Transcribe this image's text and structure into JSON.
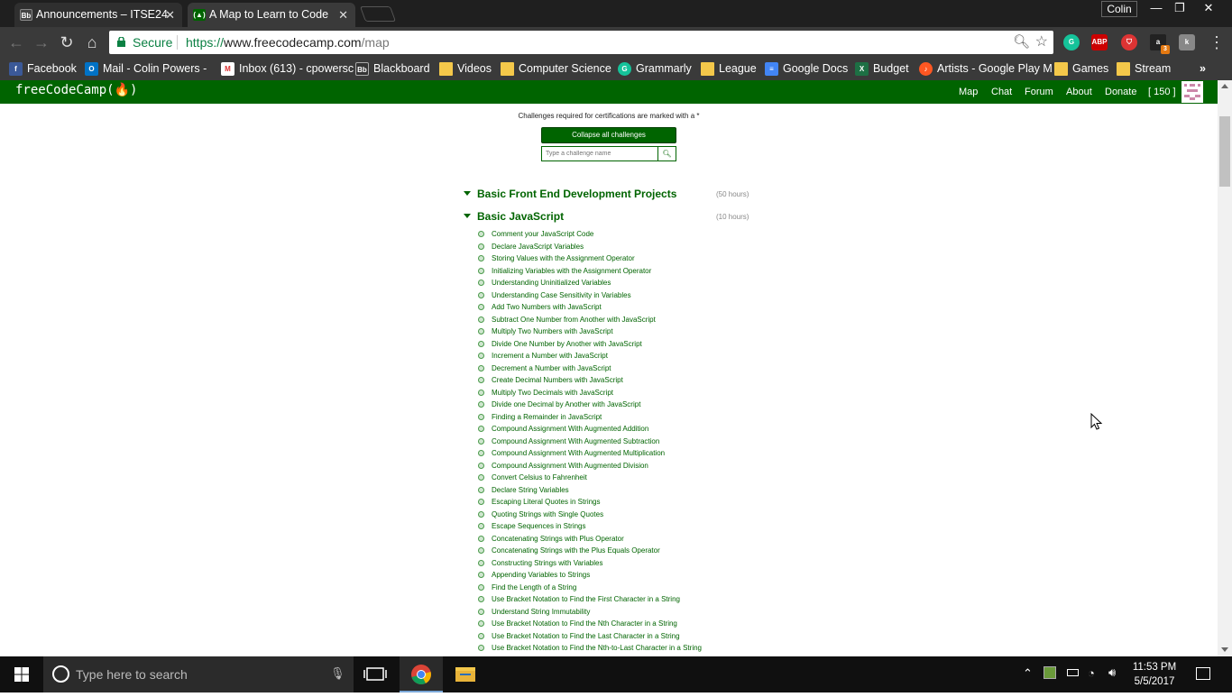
{
  "browser": {
    "tabs": [
      {
        "title": "Announcements – ITSE24",
        "icon": "Bb",
        "active": false
      },
      {
        "title": "A Map to Learn to Code",
        "icon": "fcc",
        "active": true
      }
    ],
    "profile_name": "Colin",
    "secure_label": "Secure",
    "url_scheme": "https://",
    "url_host": "www.freecodecamp.com",
    "url_path": "/map",
    "extension_badge": "3"
  },
  "bookmarks": [
    {
      "label": "Facebook",
      "icon": "facebook-icon"
    },
    {
      "label": "Mail - Colin Powers -",
      "icon": "outlook-icon"
    },
    {
      "label": "Inbox (613) - cpowersc",
      "icon": "gmail-icon"
    },
    {
      "label": "Blackboard",
      "icon": "blackboard-icon"
    },
    {
      "label": "Videos",
      "icon": "folder-icon"
    },
    {
      "label": "Computer Science",
      "icon": "folder-icon"
    },
    {
      "label": "Grammarly",
      "icon": "grammarly-icon"
    },
    {
      "label": "League",
      "icon": "folder-icon"
    },
    {
      "label": "Google Docs",
      "icon": "docs-icon"
    },
    {
      "label": "Budget",
      "icon": "sheets-icon"
    },
    {
      "label": "Artists - Google Play M",
      "icon": "play-music-icon"
    },
    {
      "label": "Games",
      "icon": "folder-icon"
    },
    {
      "label": "Stream",
      "icon": "folder-icon"
    }
  ],
  "site": {
    "logo": "freeCodeCamp(🔥)",
    "nav": [
      "Map",
      "Chat",
      "Forum",
      "About",
      "Donate",
      "[ 150 ]"
    ],
    "brand_color": "#006400"
  },
  "map": {
    "note": "Challenges required for certifications are marked with a *",
    "collapse_label": "Collapse all challenges",
    "search_placeholder": "Type a challenge name",
    "sections": [
      {
        "title": "Basic Front End Development Projects",
        "hours": "(50 hours)"
      },
      {
        "title": "Basic JavaScript",
        "hours": "(10 hours)"
      }
    ],
    "challenges": [
      "Comment your JavaScript Code",
      "Declare JavaScript Variables",
      "Storing Values with the Assignment Operator",
      "Initializing Variables with the Assignment Operator",
      "Understanding Uninitialized Variables",
      "Understanding Case Sensitivity in Variables",
      "Add Two Numbers with JavaScript",
      "Subtract One Number from Another with JavaScript",
      "Multiply Two Numbers with JavaScript",
      "Divide One Number by Another with JavaScript",
      "Increment a Number with JavaScript",
      "Decrement a Number with JavaScript",
      "Create Decimal Numbers with JavaScript",
      "Multiply Two Decimals with JavaScript",
      "Divide one Decimal by Another with JavaScript",
      "Finding a Remainder in JavaScript",
      "Compound Assignment With Augmented Addition",
      "Compound Assignment With Augmented Subtraction",
      "Compound Assignment With Augmented Multiplication",
      "Compound Assignment With Augmented Division",
      "Convert Celsius to Fahrenheit",
      "Declare String Variables",
      "Escaping Literal Quotes in Strings",
      "Quoting Strings with Single Quotes",
      "Escape Sequences in Strings",
      "Concatenating Strings with Plus Operator",
      "Concatenating Strings with the Plus Equals Operator",
      "Constructing Strings with Variables",
      "Appending Variables to Strings",
      "Find the Length of a String",
      "Use Bracket Notation to Find the First Character in a String",
      "Understand String Immutability",
      "Use Bracket Notation to Find the Nth Character in a String",
      "Use Bracket Notation to Find the Last Character in a String",
      "Use Bracket Notation to Find the Nth-to-Last Character in a String"
    ]
  },
  "taskbar": {
    "search_placeholder": "Type here to search",
    "time": "11:53 PM",
    "date": "5/5/2017"
  }
}
